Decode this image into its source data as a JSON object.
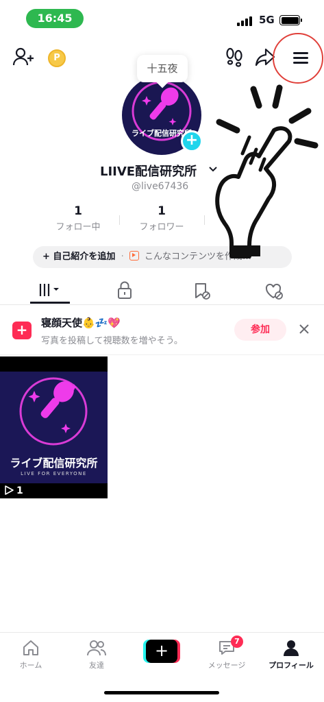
{
  "status_bar": {
    "time": "16:45",
    "network": "5G"
  },
  "header": {
    "coin_icon": "coin-icon",
    "menu_icon": "hamburger-menu-icon"
  },
  "profile": {
    "note_bubble": "十五夜",
    "display_name": "LIIVE配信研究所",
    "handle": "@live67436",
    "following_count": "1",
    "following_label": "フォロー中",
    "followers_count": "1",
    "followers_label": "フォロワー",
    "bio_add_label": "+ 自己紹介を追加",
    "bio_separator": "·",
    "bio_suggest": "こんなコンテンツを作成…"
  },
  "banner": {
    "title": "寝顔天使👶💤💖",
    "subtitle": "写真を投稿して視聴数を増やそう。",
    "join_label": "参加"
  },
  "videos": [
    {
      "title": "ライブ配信研究所",
      "subtitle": "LIVE FOR EVERYONE",
      "views": "1"
    }
  ],
  "avatar": {
    "title": "ライブ配信研究所"
  },
  "nav": {
    "home": "ホーム",
    "friends": "友達",
    "messages": "メッセージ",
    "messages_badge": "7",
    "profile": "プロフィール"
  },
  "colors": {
    "accent": "#fe2c55",
    "cyan": "#20d5ec",
    "time_pill": "#2eb850",
    "highlight_circle": "#e0403a"
  }
}
